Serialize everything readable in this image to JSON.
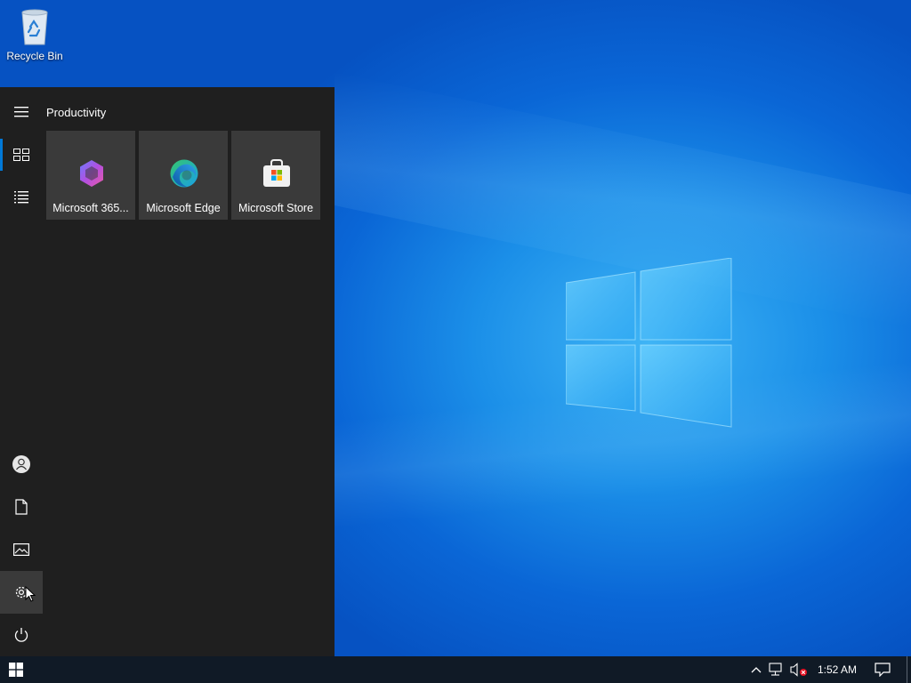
{
  "desktop": {
    "icons": [
      {
        "label": "Recycle Bin",
        "icon": "recycle-bin-icon"
      }
    ]
  },
  "start_menu": {
    "rail": {
      "top": [
        {
          "icon": "hamburger-menu-icon"
        },
        {
          "icon": "tiles-icon",
          "active": true
        },
        {
          "icon": "all-apps-list-icon"
        }
      ],
      "bottom": [
        {
          "icon": "user-account-icon"
        },
        {
          "icon": "documents-icon"
        },
        {
          "icon": "pictures-icon"
        },
        {
          "icon": "settings-gear-icon",
          "hovered": true
        },
        {
          "icon": "power-icon"
        }
      ]
    },
    "group_title": "Productivity",
    "tiles": [
      {
        "label": "Microsoft 365...",
        "icon": "microsoft-365-icon"
      },
      {
        "label": "Microsoft Edge",
        "icon": "edge-icon"
      },
      {
        "label": "Microsoft Store",
        "icon": "store-icon"
      }
    ]
  },
  "taskbar": {
    "start_icon": "windows-logo-icon",
    "tray_icons": [
      "chevron-up-icon",
      "network-icon",
      "volume-muted-icon"
    ],
    "clock": "1:52 AM",
    "notifications_icon": "action-center-icon"
  },
  "colors": {
    "accent": "#0078d7",
    "start_bg": "#1f1f1f",
    "tile_bg": "#3a3a3a",
    "taskbar_bg": "#101a26"
  }
}
